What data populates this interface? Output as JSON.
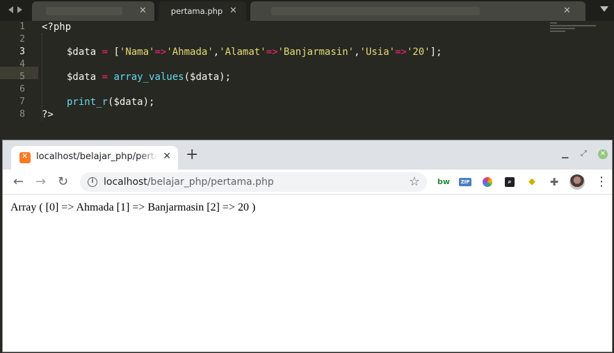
{
  "editor": {
    "tabs": [
      {
        "label": "",
        "blurred": true
      },
      {
        "label": "pertama.php",
        "active": true
      },
      {
        "label": "",
        "blurred": true
      }
    ],
    "line_numbers": [
      "1",
      "2",
      "3",
      "4",
      "5",
      "6",
      "7",
      "8"
    ],
    "highlighted_line": "3",
    "code": {
      "l1": "<?php",
      "l3": {
        "var": "$data",
        "op1": " = ",
        "b1": "[",
        "s1": "'Nama'",
        "a1": "=>",
        "s2": "'Ahmada'",
        "c1": ",",
        "s3": "'Alamat'",
        "a2": "=>",
        "s4": "'Banjarmasin'",
        "c2": ",",
        "s5": "'Usia'",
        "a3": "=>",
        "s6": "'20'",
        "end": "];"
      },
      "l5": {
        "var": "$data",
        "op": " = ",
        "fn": "array_values",
        "args": "($data);"
      },
      "l7": {
        "fn": "print_r",
        "args": "($data);"
      },
      "l8": "?>"
    }
  },
  "browser": {
    "tab_title": "localhost/belajar_php/pertama.php",
    "new_tab": "+",
    "url_host": "localhost",
    "url_path": "/belajar_php/pertama.php",
    "output": "Array ( [0] => Ahmada [1] => Banjarmasin [2] => 20 )",
    "extensions": {
      "bw": "bw",
      "zip": "ZIP"
    }
  }
}
